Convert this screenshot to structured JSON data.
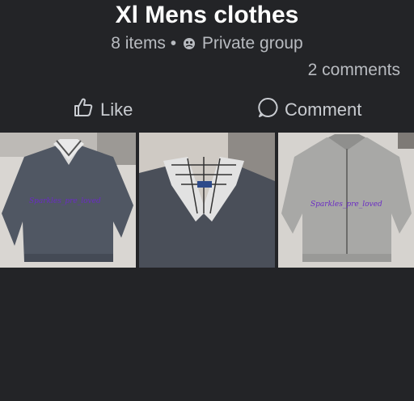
{
  "post": {
    "title": "Xl Mens clothes",
    "item_count": "8 items",
    "separator": "•",
    "privacy_label": "Private group",
    "privacy_icon": "globe-icon",
    "comments_count": "2 comments"
  },
  "actions": {
    "like_label": "Like",
    "like_icon": "thumbs-up-icon",
    "comment_label": "Comment",
    "comment_icon": "comment-bubble-icon"
  },
  "photos": [
    {
      "watermark": "Sparkles_pre_loved"
    },
    {
      "watermark": ""
    },
    {
      "watermark": "Sparkles_pre_loved"
    }
  ],
  "colors": {
    "background": "#232427",
    "text_primary": "#ffffff",
    "text_secondary": "#b8bbc0",
    "watermark": "#6a2cc4"
  }
}
